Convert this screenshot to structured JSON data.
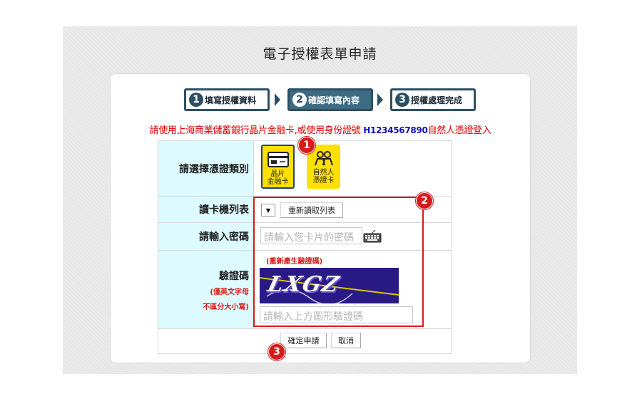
{
  "page": {
    "title": "電子授權表單申請"
  },
  "steps": [
    {
      "num": "1",
      "label": "填寫授權資料"
    },
    {
      "num": "2",
      "label": "確認填寫內容"
    },
    {
      "num": "3",
      "label": "授權處理完成"
    }
  ],
  "notice": {
    "prefix": "請使用上海商業儲蓄銀行晶片金融卡,或使用身份證號 ",
    "id_example": "H1234567890",
    "suffix": "自然人憑證登入"
  },
  "form": {
    "cert_type_label": "請選擇憑證類別",
    "cert_options": [
      {
        "line1": "晶片",
        "line2": "金融卡",
        "icon": "chip-card-icon",
        "selected": true
      },
      {
        "line1": "自然人",
        "line2": "憑證卡",
        "icon": "people-icon",
        "selected": false
      }
    ],
    "reader_label": "讀卡機列表",
    "reader_select_value": "▼",
    "reload_list_button": "重新讀取列表",
    "password_label": "請輸入密碼",
    "password_placeholder": "請輸入您卡片的密碼",
    "captcha_label": "驗證碼",
    "captcha_note_line1": "(僅英文字母",
    "captcha_note_line2": "不區分大小寫)",
    "captcha_refresh_link": "(重新產生驗證碼)",
    "captcha_text": "LXGZ",
    "captcha_placeholder": "請輸入上方圖形驗證碼",
    "confirm_button": "確定申請",
    "cancel_button": "取消"
  },
  "annotations": {
    "badge1": "1",
    "badge2": "2",
    "badge3": "3"
  },
  "colors": {
    "accent_red": "#d71a1a",
    "step_dark": "#2d4f63",
    "label_bg": "#ddfbff",
    "captcha_bg": "#2a1a86",
    "card_yellow": "#ffe000"
  }
}
